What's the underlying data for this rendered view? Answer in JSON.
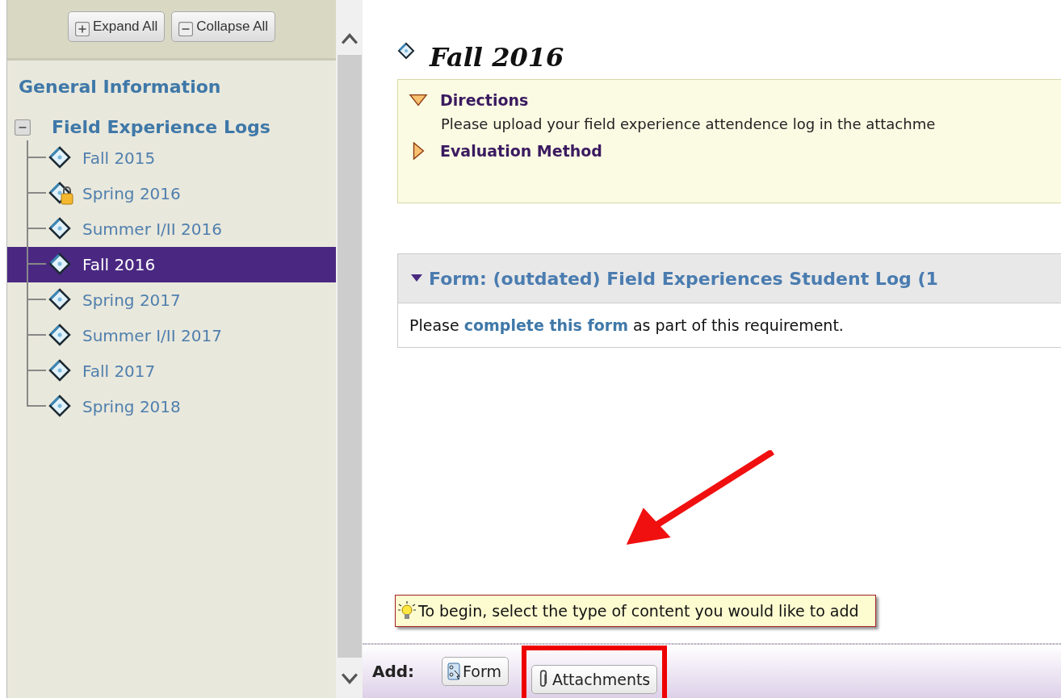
{
  "toolbar": {
    "buttons": [
      {
        "label": "Expand All",
        "kind": "expand"
      },
      {
        "label": "Collapse All",
        "kind": "collapse"
      }
    ]
  },
  "sidebar": {
    "items": [
      {
        "label": "General Information",
        "kind": "link"
      },
      {
        "label": "Field Experience Logs",
        "kind": "folder",
        "expanded": true,
        "children": [
          {
            "label": "Fall 2015",
            "selected": false,
            "locked": false
          },
          {
            "label": "Spring 2016",
            "selected": false,
            "locked": true
          },
          {
            "label": "Summer I/II 2016",
            "selected": false,
            "locked": false
          },
          {
            "label": "Fall 2016",
            "selected": true,
            "locked": false
          },
          {
            "label": "Spring 2017",
            "selected": false,
            "locked": false
          },
          {
            "label": "Summer I/II 2017",
            "selected": false,
            "locked": false
          },
          {
            "label": "Fall 2017",
            "selected": false,
            "locked": false
          },
          {
            "label": "Spring 2018",
            "selected": false,
            "locked": false
          }
        ]
      }
    ]
  },
  "page": {
    "title": "Fall 2016",
    "sections": [
      {
        "title": "Directions",
        "expanded": true,
        "text": "Please upload your field experience attendence log in the attachme"
      },
      {
        "title": "Evaluation Method",
        "expanded": false
      }
    ],
    "form_panel": {
      "title": "Form: (outdated) Field Experiences Student Log (1",
      "expanded": true,
      "text_before": "Please",
      "link": "complete this form",
      "text_after": "as part of this requirement."
    }
  },
  "tooltip": {
    "text": "To begin, select the type of content you would like to add"
  },
  "add_bar": {
    "label": "Add:",
    "buttons": [
      {
        "label": "Form",
        "kind": "form",
        "highlighted": false
      },
      {
        "label": "Attachments",
        "kind": "attachment",
        "highlighted": true
      }
    ]
  }
}
